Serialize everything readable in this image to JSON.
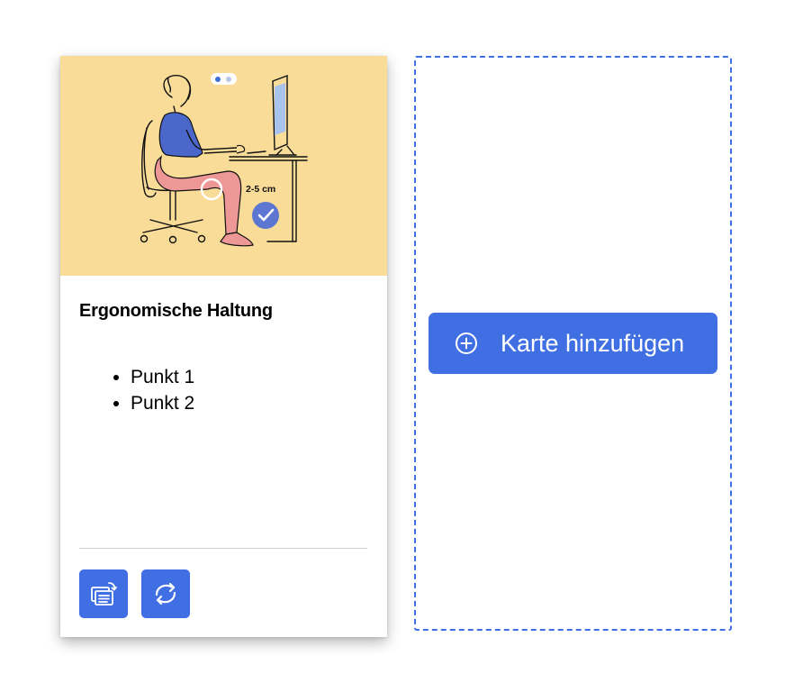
{
  "card": {
    "title": "Ergonomische Haltung",
    "points": [
      "Punkt 1",
      "Punkt 2"
    ],
    "illustration": {
      "measurement_label": "2-5 cm",
      "pager": {
        "count": 2,
        "active_index": 0
      }
    },
    "actions": [
      {
        "icon": "flip-card-icon"
      },
      {
        "icon": "replace-card-icon"
      }
    ]
  },
  "add_card": {
    "label": "Karte hinzufügen",
    "icon": "plus-circle-icon"
  },
  "colors": {
    "accent": "#3f6fe3",
    "illustration_background": "#f9dc98",
    "shirt": "#4a67c9",
    "legs": "#ee9797",
    "screen": "#a9c4ec",
    "divider": "#cfcfcf"
  }
}
